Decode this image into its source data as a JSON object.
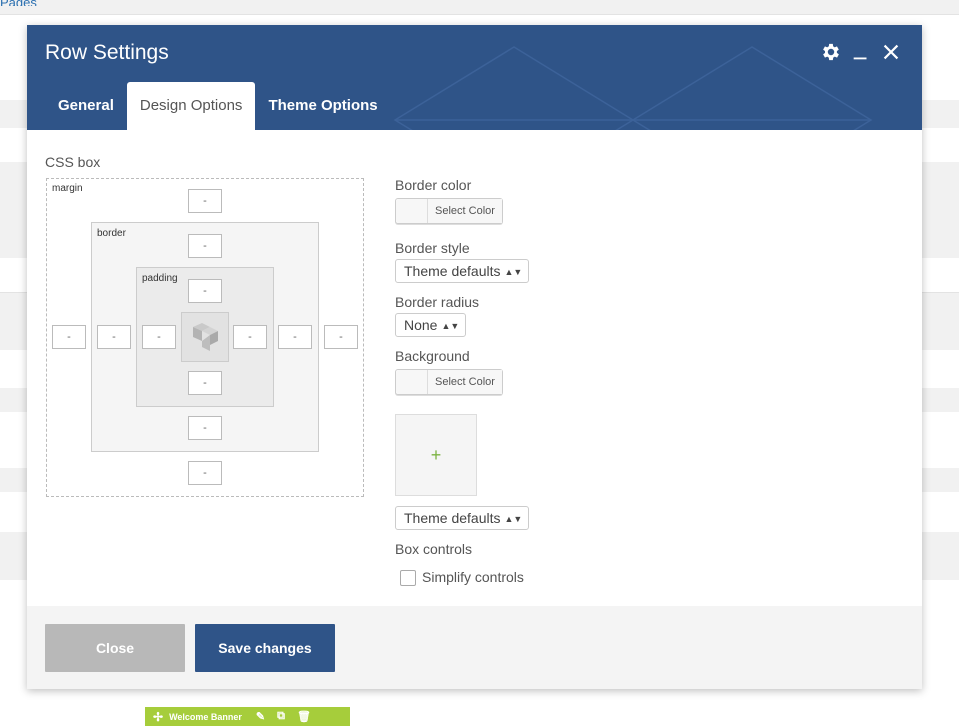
{
  "page": {
    "background_link": "Pages"
  },
  "modal": {
    "title": "Row Settings",
    "tabs": [
      {
        "label": "General",
        "active": false
      },
      {
        "label": "Design Options",
        "active": true
      },
      {
        "label": "Theme Options",
        "active": false
      }
    ],
    "css_box": {
      "label": "CSS box",
      "margin_label": "margin",
      "border_label": "border",
      "padding_label": "padding",
      "margin": {
        "top": "-",
        "right": "-",
        "bottom": "-",
        "left": "-"
      },
      "border": {
        "top": "-",
        "right": "-",
        "bottom": "-",
        "left": "-"
      },
      "padding": {
        "top": "-",
        "right": "-",
        "bottom": "-",
        "left": "-"
      }
    },
    "border_color": {
      "label": "Border color",
      "button": "Select Color"
    },
    "border_style": {
      "label": "Border style",
      "value": "Theme defaults"
    },
    "border_radius": {
      "label": "Border radius",
      "value": "None"
    },
    "background": {
      "label": "Background",
      "button": "Select Color",
      "image_add": "+",
      "style_value": "Theme defaults"
    },
    "box_controls": {
      "label": "Box controls",
      "simplify_label": "Simplify controls",
      "checked": false
    },
    "footer": {
      "close_label": "Close",
      "save_label": "Save changes"
    }
  },
  "element_bar": {
    "label": "Welcome Banner"
  },
  "colors": {
    "header": "#2f5488",
    "save_button": "#2f5488",
    "close_button": "#b8b8b8",
    "element_bar": "#a6cd3b",
    "add_image_plus": "#7cb342"
  }
}
